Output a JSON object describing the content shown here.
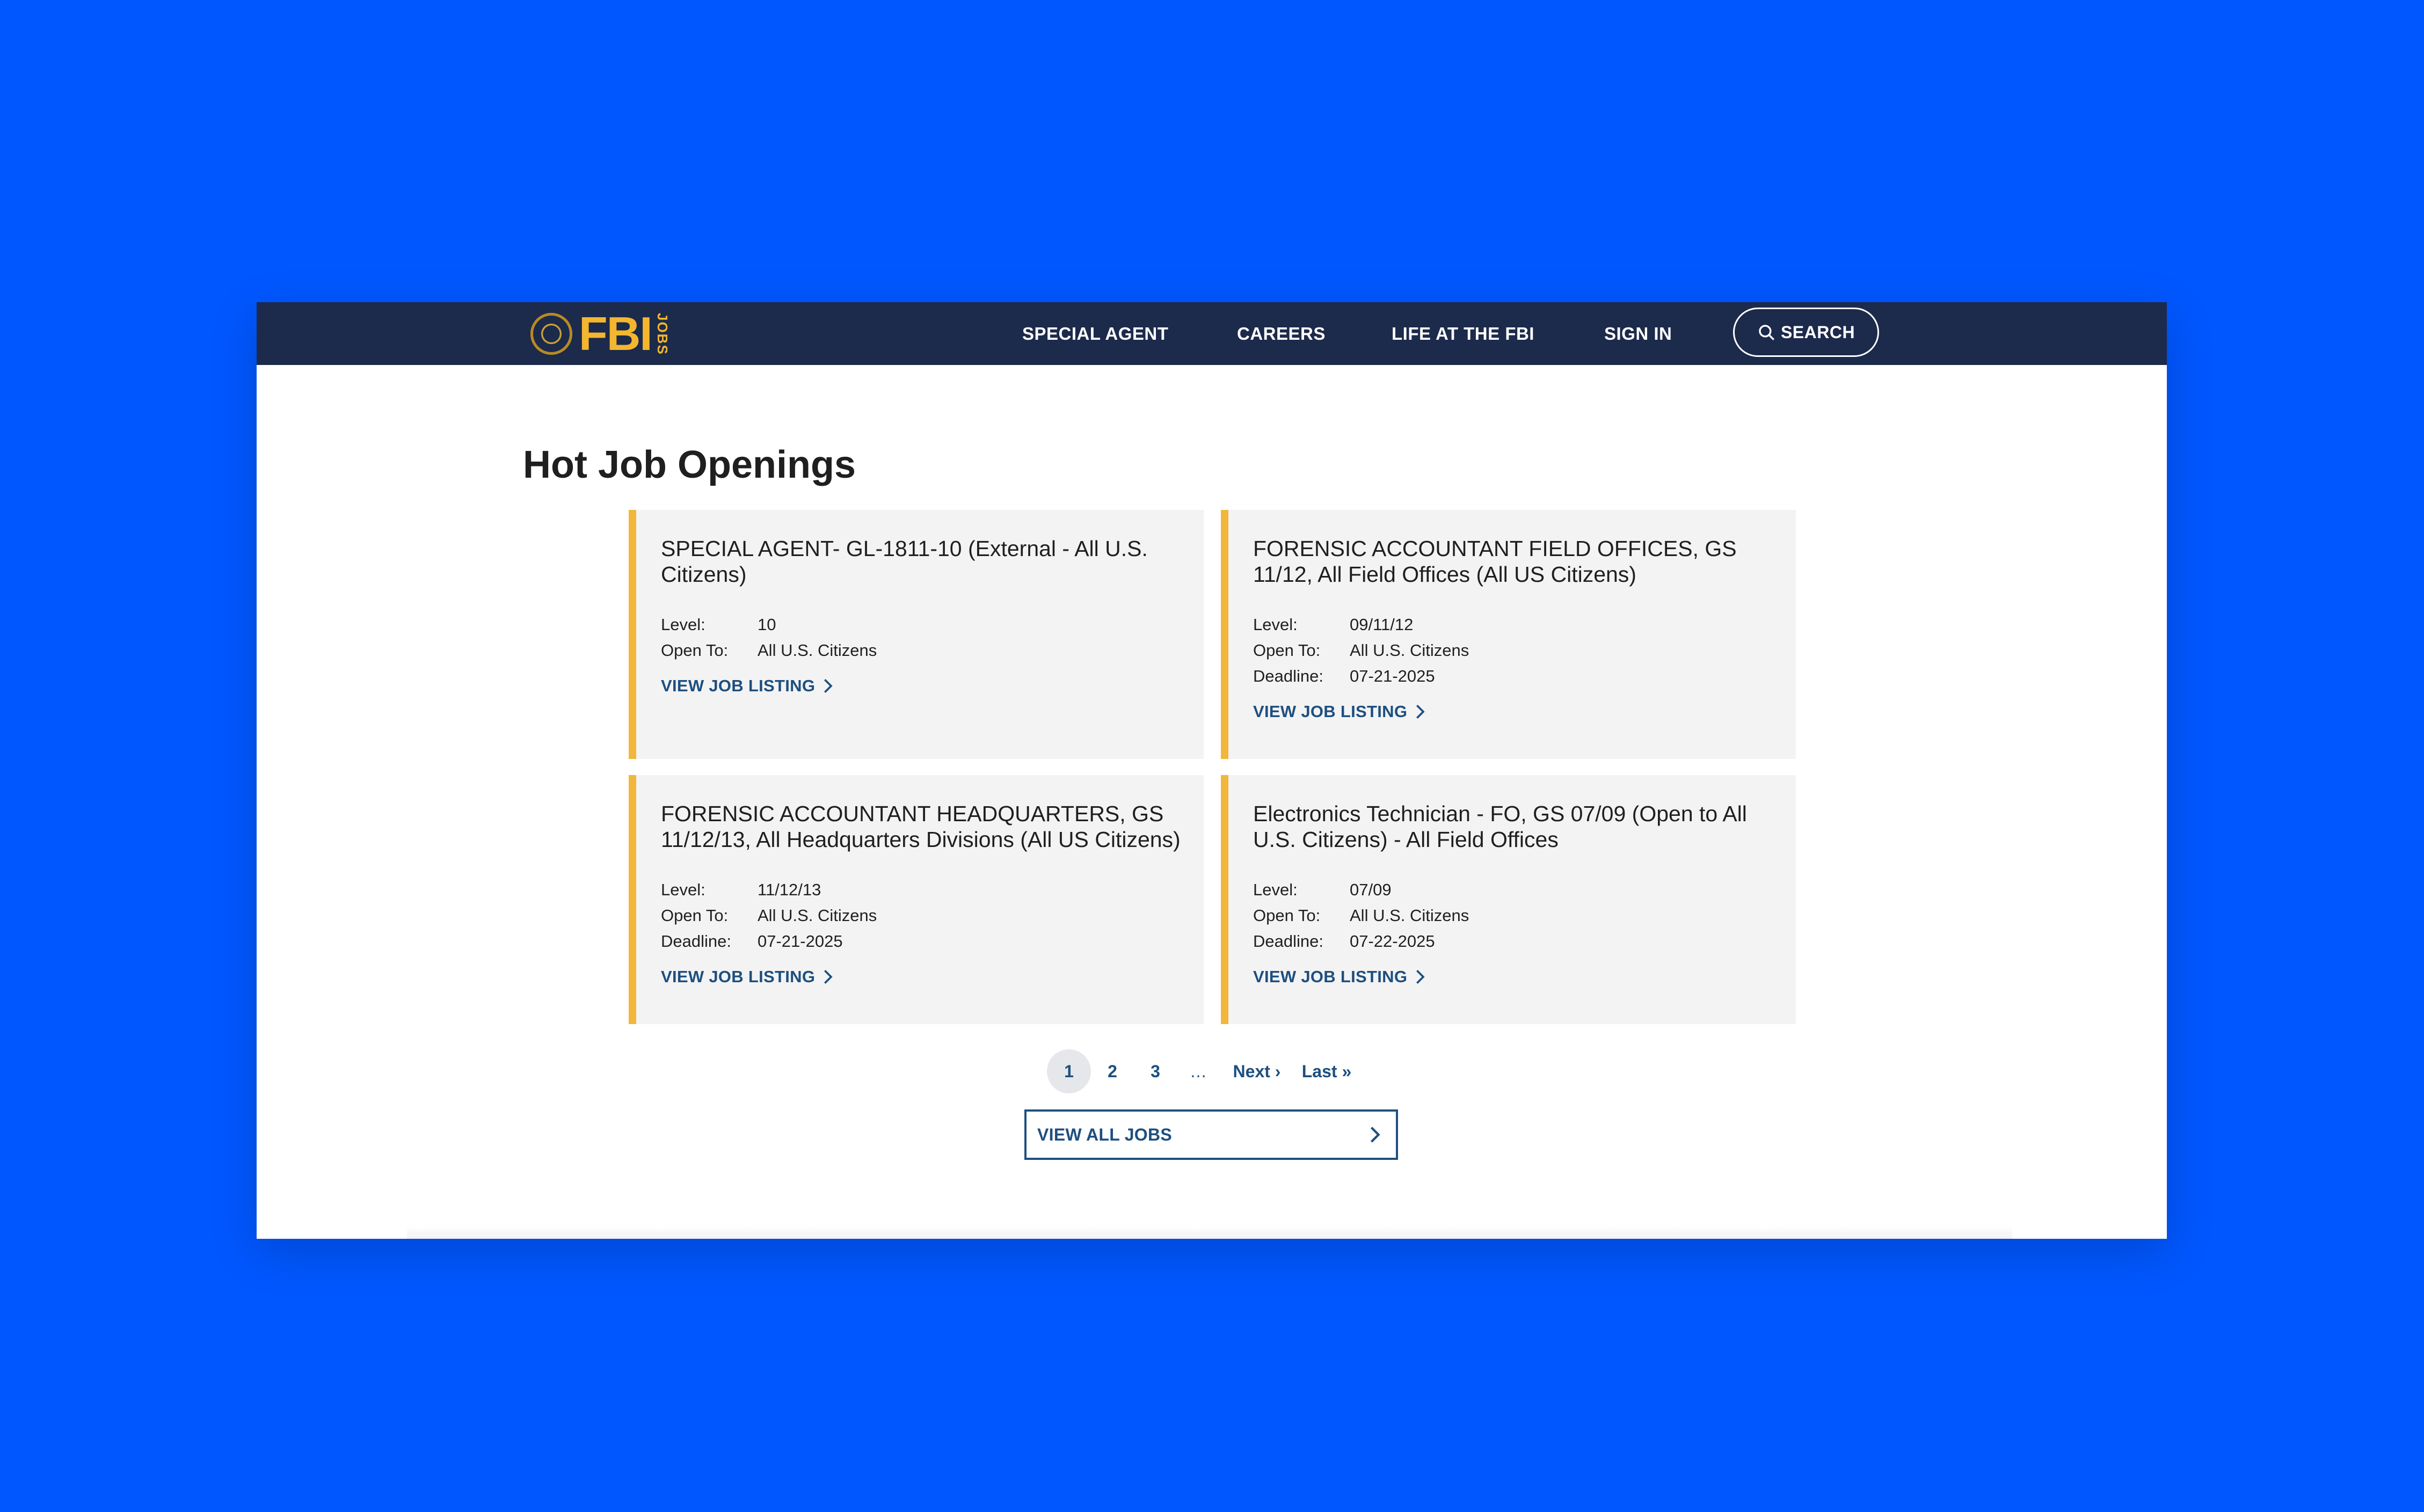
{
  "brand": {
    "logo_text": "FBI",
    "logo_subtext": "JOBS"
  },
  "nav": {
    "items": [
      {
        "label": "SPECIAL AGENT"
      },
      {
        "label": "CAREERS"
      },
      {
        "label": "LIFE AT THE FBI"
      },
      {
        "label": "SIGN IN"
      }
    ],
    "search_label": "SEARCH"
  },
  "main": {
    "heading": "Hot Job Openings",
    "link_label": "VIEW JOB LISTING",
    "labels": {
      "level": "Level:",
      "open_to": "Open To:",
      "deadline": "Deadline:"
    },
    "jobs": [
      {
        "title": "SPECIAL AGENT- GL-1811-10 (External - All U.S. Citizens)",
        "level": "10",
        "open_to": "All U.S. Citizens",
        "deadline": ""
      },
      {
        "title": "FORENSIC ACCOUNTANT FIELD OFFICES, GS 11/12, All Field Offices (All US Citizens)",
        "level": "09/11/12",
        "open_to": "All U.S. Citizens",
        "deadline": "07-21-2025"
      },
      {
        "title": "FORENSIC ACCOUNTANT HEADQUARTERS, GS 11/12/13, All Headquarters Divisions (All US Citizens)",
        "level": "11/12/13",
        "open_to": "All U.S. Citizens",
        "deadline": "07-21-2025"
      },
      {
        "title": "Electronics Technician - FO, GS 07/09 (Open to All U.S. Citizens) - All Field Offices",
        "level": "07/09",
        "open_to": "All U.S. Citizens",
        "deadline": "07-22-2025"
      }
    ]
  },
  "pagination": {
    "pages": [
      "1",
      "2",
      "3"
    ],
    "ellipsis": "…",
    "next": "Next ›",
    "last": "Last »"
  },
  "view_all_label": "VIEW ALL JOBS",
  "colors": {
    "background": "#0057ff",
    "navbar": "#1c2a4b",
    "accent_yellow": "#f0b73b",
    "link_blue": "#1d4f80",
    "card_bg": "#f3f3f3"
  }
}
